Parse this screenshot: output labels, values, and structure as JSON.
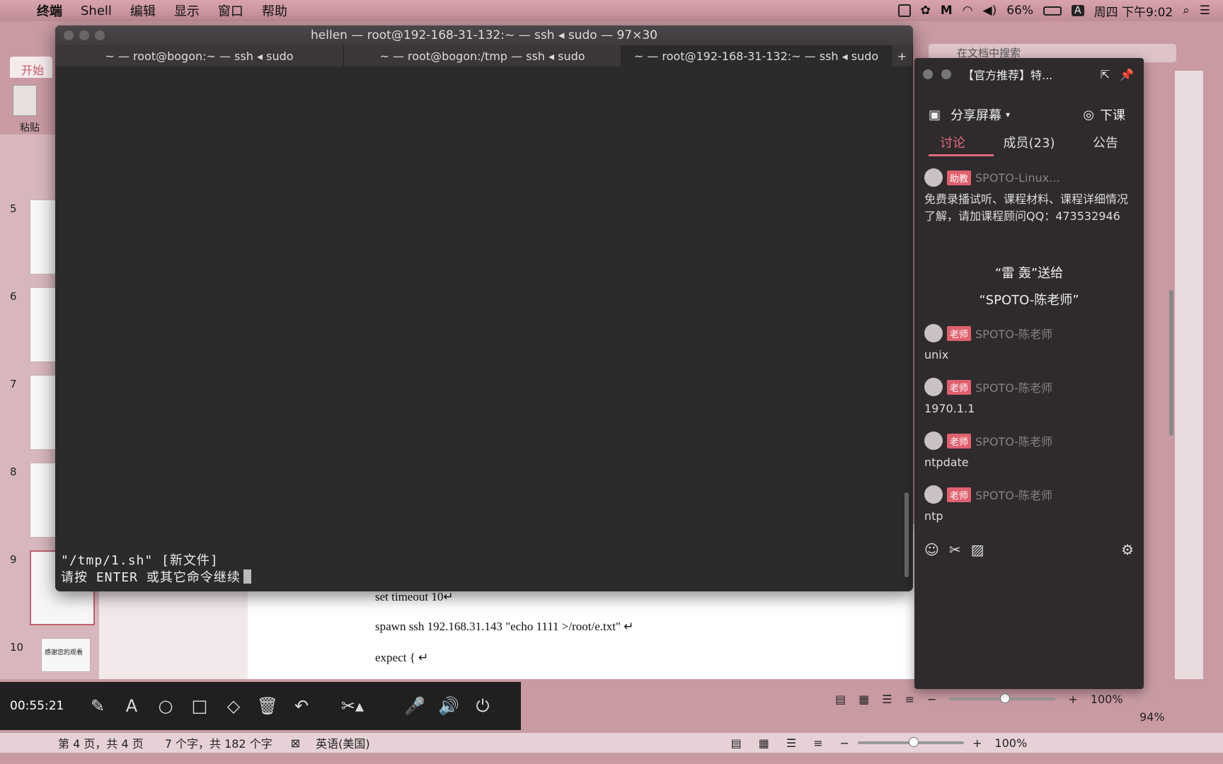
{
  "menubar": {
    "items": [
      "终端",
      "Shell",
      "编辑",
      "显示",
      "窗口",
      "帮助"
    ],
    "battery": "66%",
    "clock": "周四 下午9:02",
    "input": "A"
  },
  "word": {
    "tab_label": "开始",
    "paste_label": "粘贴",
    "search_placeholder": "在文档中搜索",
    "slide_numbers": [
      "5",
      "6",
      "7",
      "8",
      "9",
      "10"
    ],
    "thumb_text_10": "感谢您的观看",
    "doc_lines": [
      "set timeout 10↵",
      "spawn ssh 192.168.31.143 \"echo    1111 >/root/e.txt\"  ↵",
      "expect {  ↵"
    ],
    "status": {
      "pages": "第 4 页，共 4 页",
      "words": "7 个字，共 182 个字",
      "lang": "英语(美国)",
      "zoom": "100%",
      "zoom2": "94%"
    }
  },
  "recorder": {
    "elapsed": "00:55:21"
  },
  "terminal": {
    "title": "hellen — root@192-168-31-132:~ — ssh ◂ sudo — 97×30",
    "tabs": [
      "~ — root@bogon:~ — ssh ◂ sudo",
      "~ — root@bogon:/tmp — ssh ◂ sudo",
      "~ — root@192-168-31-132:~ — ssh ◂ sudo"
    ],
    "line1": "\"/tmp/1.sh\" [新文件]",
    "line2": "请按 ENTER 或其它命令继续"
  },
  "chat": {
    "title": "【官方推荐】特...",
    "share": "分享屏幕",
    "end": "下课",
    "tabs": [
      "讨论",
      "成员(23)",
      "公告"
    ],
    "assistant": {
      "badge": "助教",
      "name": "SPOTO-Linux...",
      "text": "免费录播试听、课程材料、课程详细情况了解，请加课程顾问QQ：473532946"
    },
    "gift_line1": "“雷 轰”送给",
    "gift_line2": "“SPOTO-陈老师”",
    "messages": [
      {
        "badge": "老师",
        "name": "SPOTO-陈老师",
        "text": "unix"
      },
      {
        "badge": "老师",
        "name": "SPOTO-陈老师",
        "text": "1970.1.1"
      },
      {
        "badge": "老师",
        "name": "SPOTO-陈老师",
        "text": "ntpdate"
      },
      {
        "badge": "老师",
        "name": "SPOTO-陈老师",
        "text": "ntp"
      }
    ]
  }
}
